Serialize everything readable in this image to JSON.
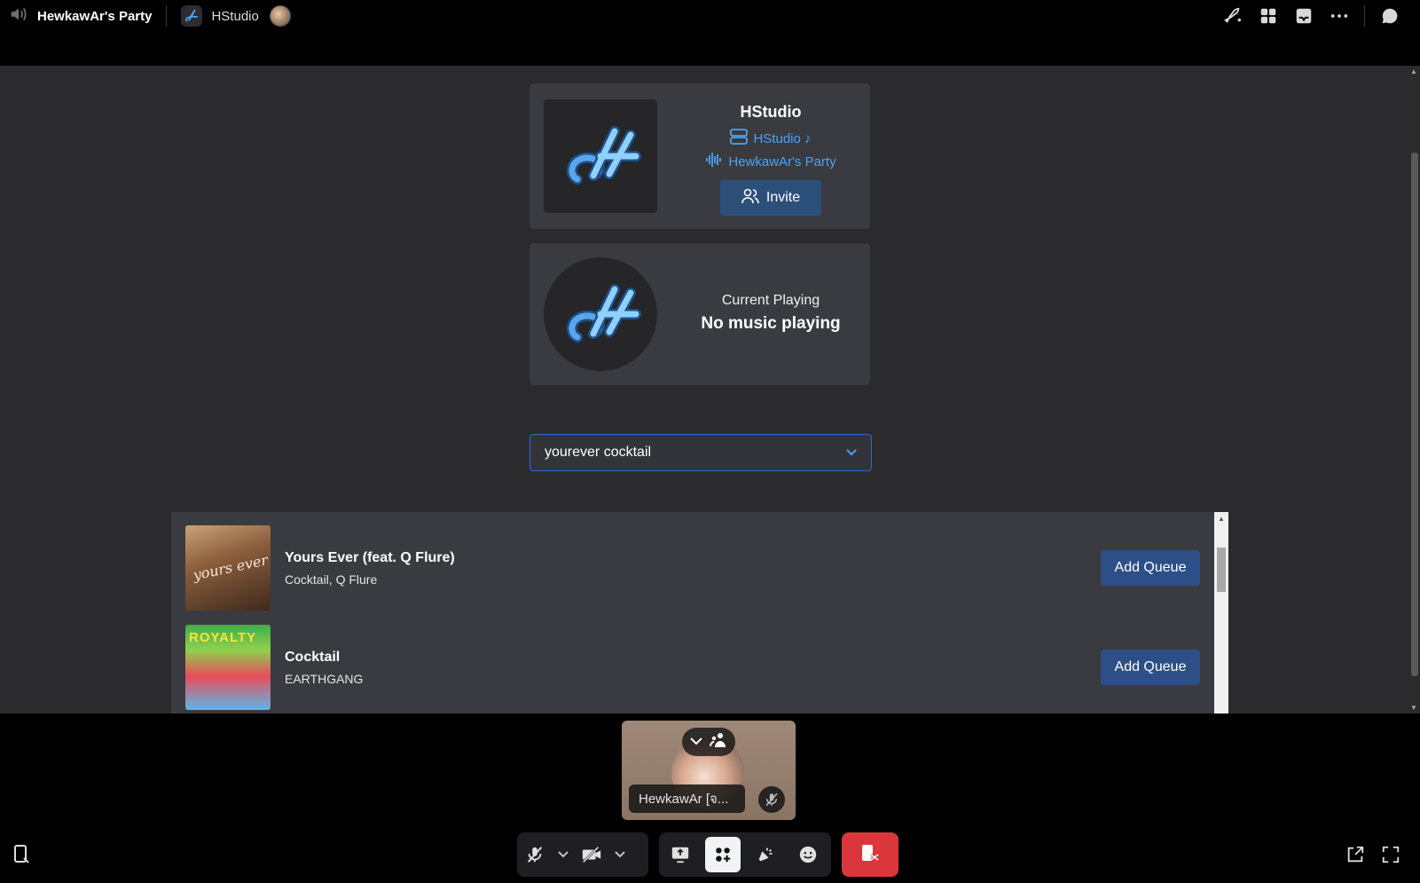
{
  "topbar": {
    "channel_name": "HewkawAr's Party",
    "app_name": "HStudio",
    "icons": [
      "speaker-icon",
      "rocket-icon",
      "grid-icon",
      "inbox-icon",
      "more-icon",
      "chat-icon"
    ]
  },
  "server_card": {
    "title": "HStudio",
    "server_link": "HStudio ♪",
    "channel_link": "HewkawAr's Party",
    "invite_label": "Invite"
  },
  "now_playing": {
    "label": "Current Playing",
    "value": "No music playing"
  },
  "search": {
    "value": "yourever cocktail"
  },
  "results": [
    {
      "title": "Yours Ever (feat. Q Flure)",
      "artists": "Cocktail, Q Flure",
      "action": "Add Queue"
    },
    {
      "title": "Cocktail",
      "artists": "EARTHGANG",
      "action": "Add Queue"
    }
  ],
  "participant": {
    "name": "HewkawAr [จ..."
  },
  "colors": {
    "accent": "#4ba3f5",
    "button": "#2d4f87",
    "end_call": "#da373c",
    "card_bg": "#3a3b40",
    "stage_bg": "#2b2b2d"
  }
}
